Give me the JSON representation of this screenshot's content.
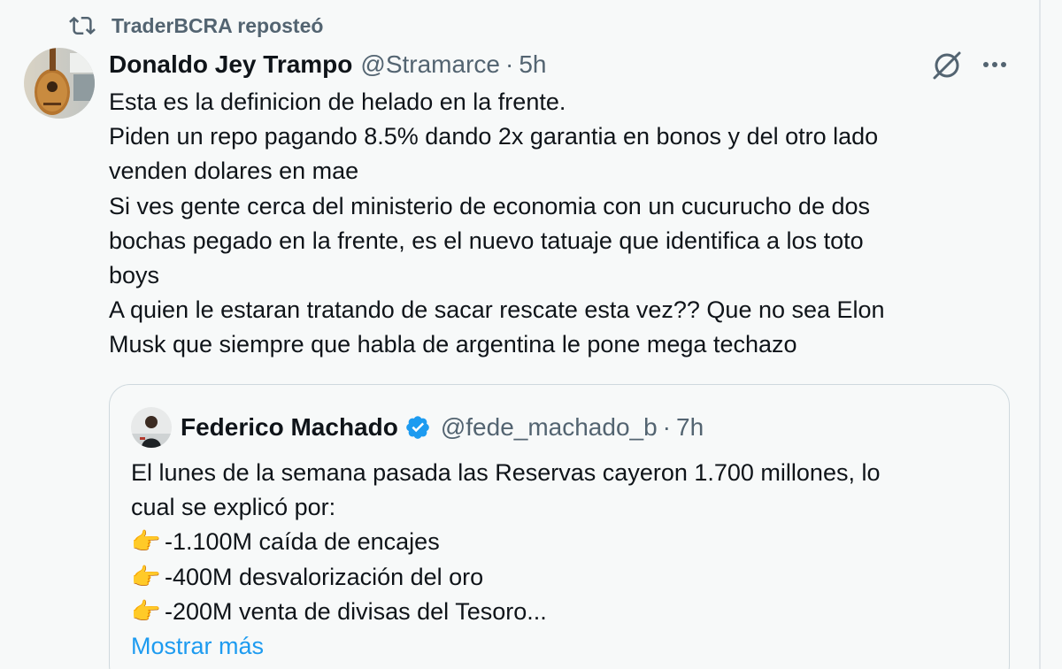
{
  "repost": {
    "label": "TraderBCRA reposteó"
  },
  "tweet": {
    "author_name": "Donaldo Jey Trampo",
    "handle": "@Stramarce",
    "separator": "·",
    "time": "5h",
    "lines": [
      "Esta es la definicion de helado en la frente.",
      "Piden un repo pagando 8.5% dando 2x garantia en bonos y del otro lado",
      "venden dolares en mae",
      "Si ves gente cerca del ministerio de economia con un cucurucho de dos",
      "bochas pegado en la frente, es el nuevo tatuaje que identifica a los toto",
      "boys",
      "A quien le estaran tratando de sacar rescate esta vez?? Que no sea Elon",
      "Musk que siempre que habla de argentina le pone mega techazo"
    ]
  },
  "quote": {
    "author_name": "Federico Machado",
    "handle": "@fede_machado_b",
    "separator": "·",
    "time": "7h",
    "lines": [
      "El lunes de la semana pasada las Reservas cayeron 1.700 millones, lo",
      "cual se explicó por:"
    ],
    "bullet_emoji": "👉",
    "bullets": [
      "-1.100M caída de encajes",
      "-400M desvalorización del oro",
      "-200M venta de divisas del Tesoro..."
    ],
    "show_more": "Mostrar más"
  },
  "colors": {
    "background": "#f7f9f9",
    "text": "#0f1419",
    "secondary": "#536471",
    "link": "#1d9bf0",
    "verified": "#1d9bf0",
    "border": "#cfd9de"
  },
  "icons": {
    "repost": "repost-icon",
    "grok": "grok-icon",
    "more": "more-icon",
    "verified": "verified-badge-icon"
  }
}
